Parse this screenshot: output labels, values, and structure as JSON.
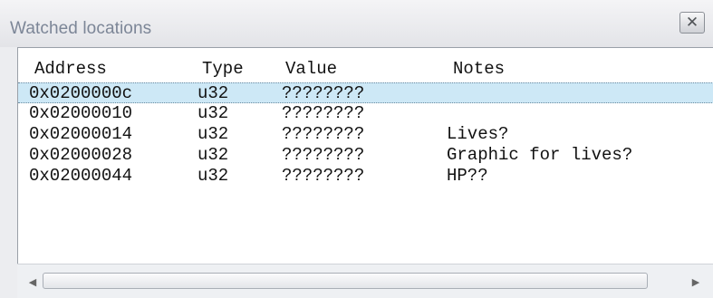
{
  "window": {
    "title": "Watched locations",
    "close_glyph": "✕"
  },
  "table": {
    "columns": [
      "Address",
      "Type",
      "Value",
      "Notes"
    ],
    "rows": [
      {
        "address": "0x0200000c",
        "type": "u32",
        "value": "????????",
        "notes": ""
      },
      {
        "address": "0x02000010",
        "type": "u32",
        "value": "????????",
        "notes": ""
      },
      {
        "address": "0x02000014",
        "type": "u32",
        "value": "????????",
        "notes": "Lives?"
      },
      {
        "address": "0x02000028",
        "type": "u32",
        "value": "????????",
        "notes": "Graphic for lives?"
      },
      {
        "address": "0x02000044",
        "type": "u32",
        "value": "????????",
        "notes": "HP??"
      }
    ],
    "selected_row": 0
  },
  "scrollbar": {
    "left_arrow": "◀",
    "right_arrow": "▶"
  },
  "colors": {
    "selection": "#cde8f6",
    "title_text": "#7c8697"
  }
}
